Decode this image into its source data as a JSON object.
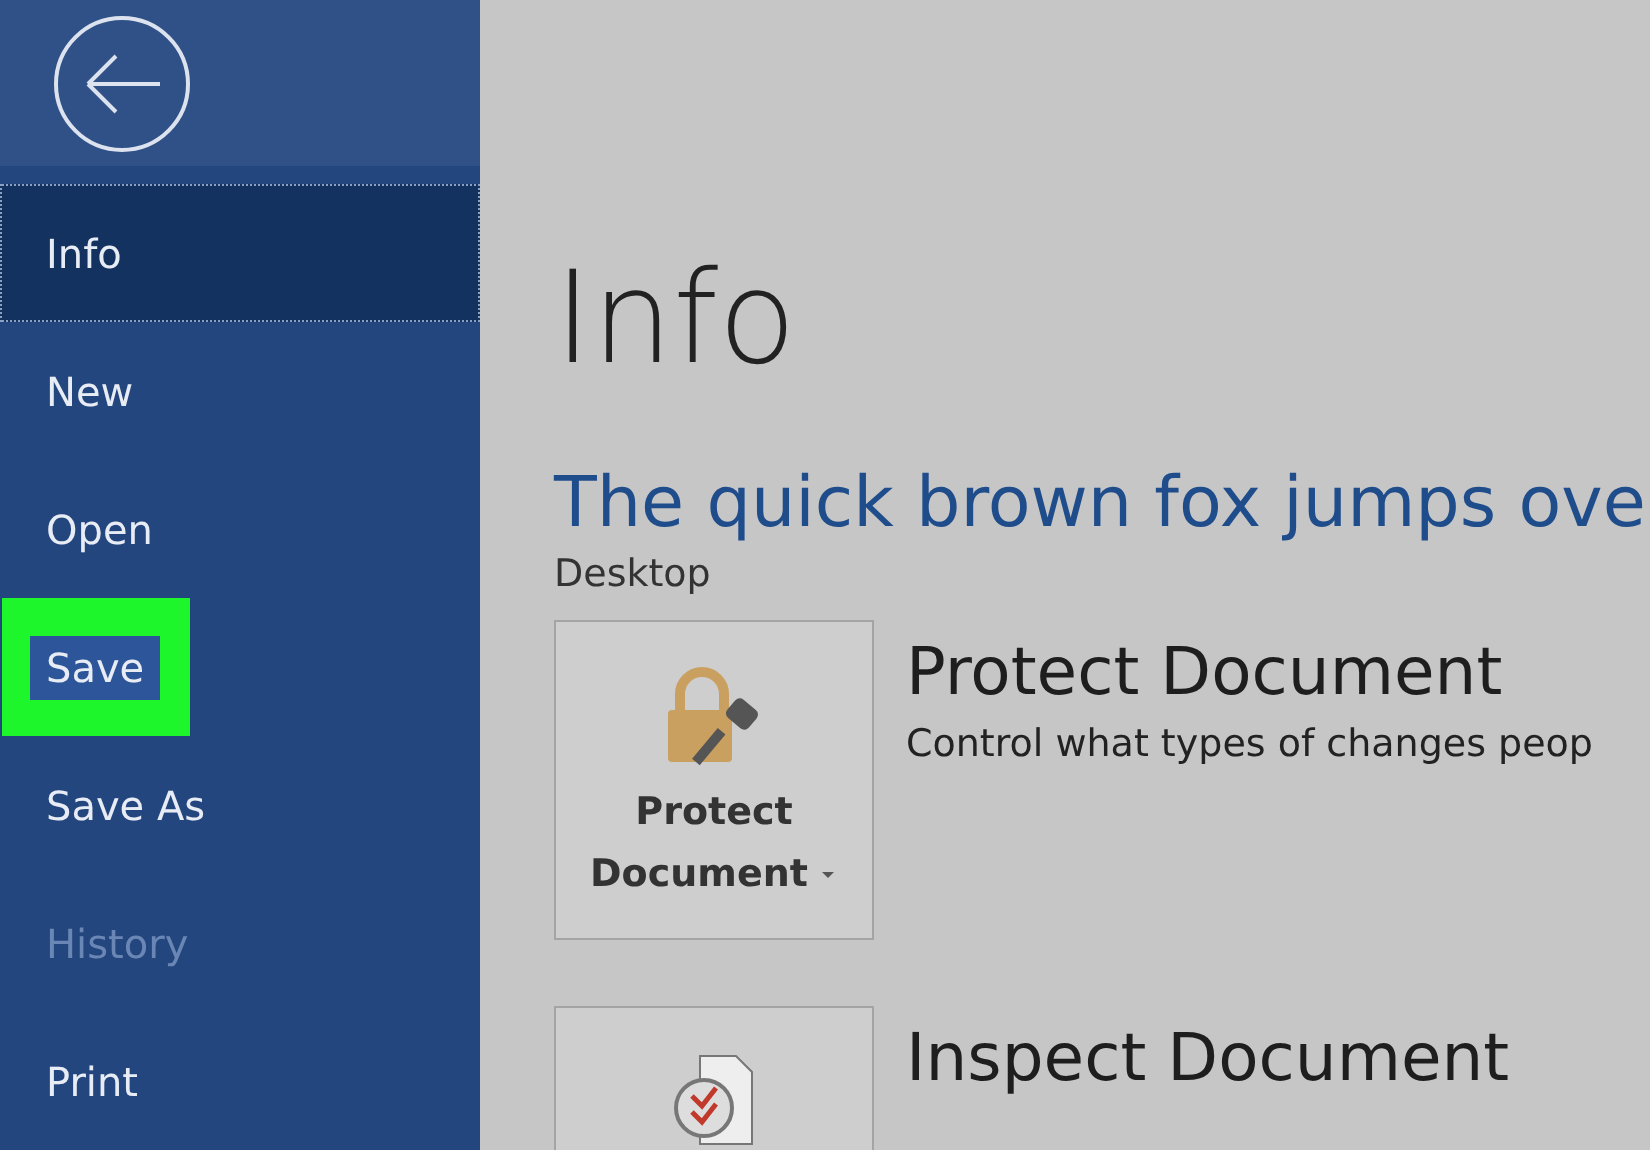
{
  "sidebar": {
    "items": [
      {
        "label": "Info",
        "selected": true,
        "disabled": false,
        "highlighted": false
      },
      {
        "label": "New",
        "selected": false,
        "disabled": false,
        "highlighted": false
      },
      {
        "label": "Open",
        "selected": false,
        "disabled": false,
        "highlighted": false
      },
      {
        "label": "Save",
        "selected": false,
        "disabled": false,
        "highlighted": true
      },
      {
        "label": "Save As",
        "selected": false,
        "disabled": false,
        "highlighted": false
      },
      {
        "label": "History",
        "selected": false,
        "disabled": true,
        "highlighted": false
      },
      {
        "label": "Print",
        "selected": false,
        "disabled": false,
        "highlighted": false
      }
    ]
  },
  "main": {
    "heading": "Info",
    "document_title": "The quick brown fox jumps ove",
    "location": "Desktop",
    "sections": [
      {
        "kind": "protect",
        "button_label": "Protect Document",
        "has_dropdown": true,
        "title": "Protect Document",
        "description": "Control what types of changes peop"
      },
      {
        "kind": "inspect",
        "title": "Inspect Document"
      }
    ]
  }
}
